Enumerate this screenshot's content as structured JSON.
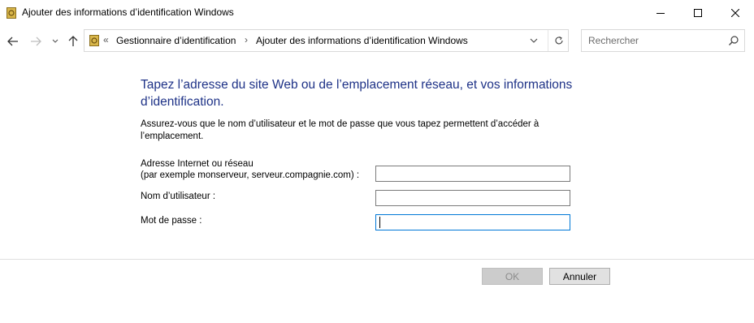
{
  "window": {
    "title": "Ajouter des informations d’identification Windows",
    "controls": {
      "minimize_icon": "minimize-icon",
      "maximize_icon": "maximize-icon",
      "close_icon": "close-icon"
    }
  },
  "nav": {
    "back_icon": "back-arrow-icon",
    "forward_icon": "forward-arrow-icon",
    "recent_icon": "chevron-down-icon",
    "up_icon": "up-arrow-icon"
  },
  "address": {
    "overflow": "«",
    "crumbs": [
      "Gestionnaire d’identification",
      "Ajouter des informations d’identification Windows"
    ],
    "separator": "›"
  },
  "search": {
    "placeholder": "Rechercher"
  },
  "content": {
    "heading": "Tapez l’adresse du site Web ou de l’emplacement réseau, et vos informations d’identification.",
    "description": "Assurez-vous que le nom d’utilisateur et le mot de passe que vous tapez permettent d’accéder à l’emplacement.",
    "fields": {
      "address_label_line1": "Adresse Internet ou réseau",
      "address_label_line2": "(par exemple monserveur, serveur.compagnie.com) :",
      "address_value": "",
      "username_label": "Nom d’utilisateur :",
      "username_value": "",
      "password_label": "Mot de passe :",
      "password_value": ""
    }
  },
  "buttons": {
    "ok": "OK",
    "cancel": "Annuler",
    "ok_enabled": false
  },
  "colors": {
    "heading": "#1e3287",
    "focus": "#0078d7"
  }
}
